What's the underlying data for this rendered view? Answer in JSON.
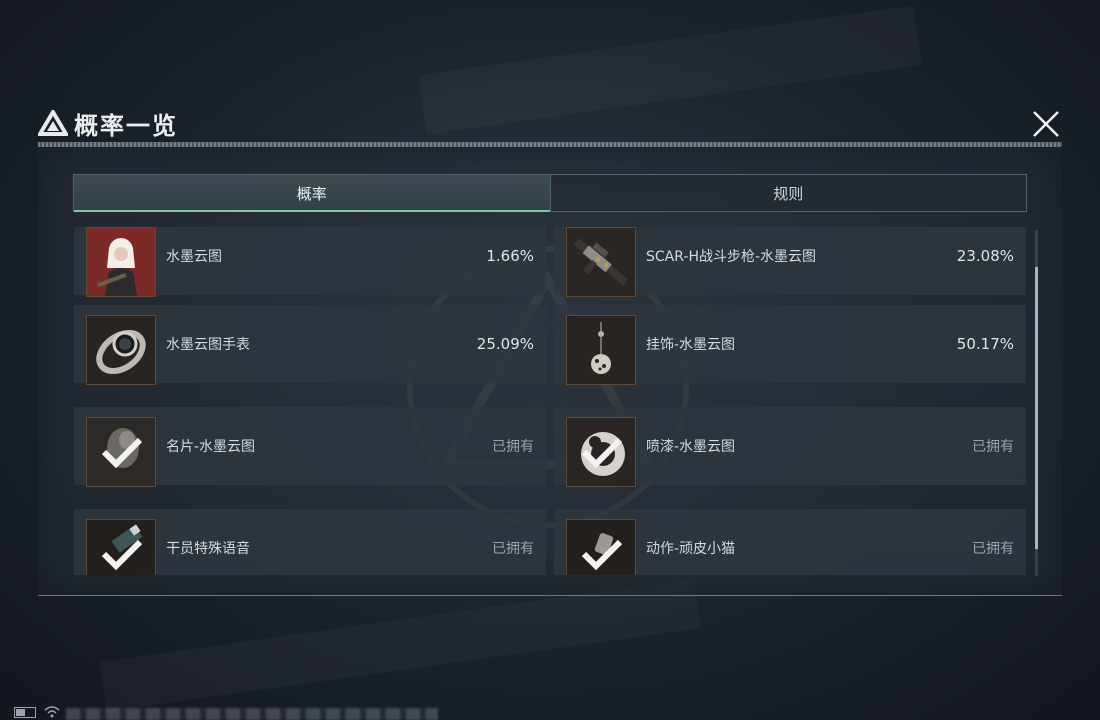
{
  "header": {
    "title": "概率一览",
    "logo_icon": "triangle-logo-icon",
    "close_icon": "close-icon"
  },
  "tabs": [
    {
      "label": "概率",
      "active": true
    },
    {
      "label": "规则",
      "active": false
    }
  ],
  "items": [
    {
      "name": "水墨云图",
      "value": "1.66%",
      "thumb": "operator-portrait",
      "owned": false
    },
    {
      "name": "SCAR-H战斗步枪-水墨云图",
      "value": "23.08%",
      "thumb": "rifle",
      "owned": false
    },
    {
      "name": "水墨云图手表",
      "value": "25.09%",
      "thumb": "watch",
      "owned": false
    },
    {
      "name": "挂饰-水墨云图",
      "value": "50.17%",
      "thumb": "charm",
      "owned": false
    },
    {
      "name": "名片-水墨云图",
      "value": "已拥有",
      "thumb": "card",
      "owned": true
    },
    {
      "name": "喷漆-水墨云图",
      "value": "已拥有",
      "thumb": "spray",
      "owned": true
    },
    {
      "name": "干员特殊语音",
      "value": "已拥有",
      "thumb": "voice",
      "owned": true
    },
    {
      "name": "动作-顽皮小猫",
      "value": "已拥有",
      "thumb": "emote",
      "owned": true
    }
  ],
  "colors": {
    "accent": "#7fc6a4",
    "panel": "#2e363e",
    "thumb_border": "#5d4a38"
  }
}
